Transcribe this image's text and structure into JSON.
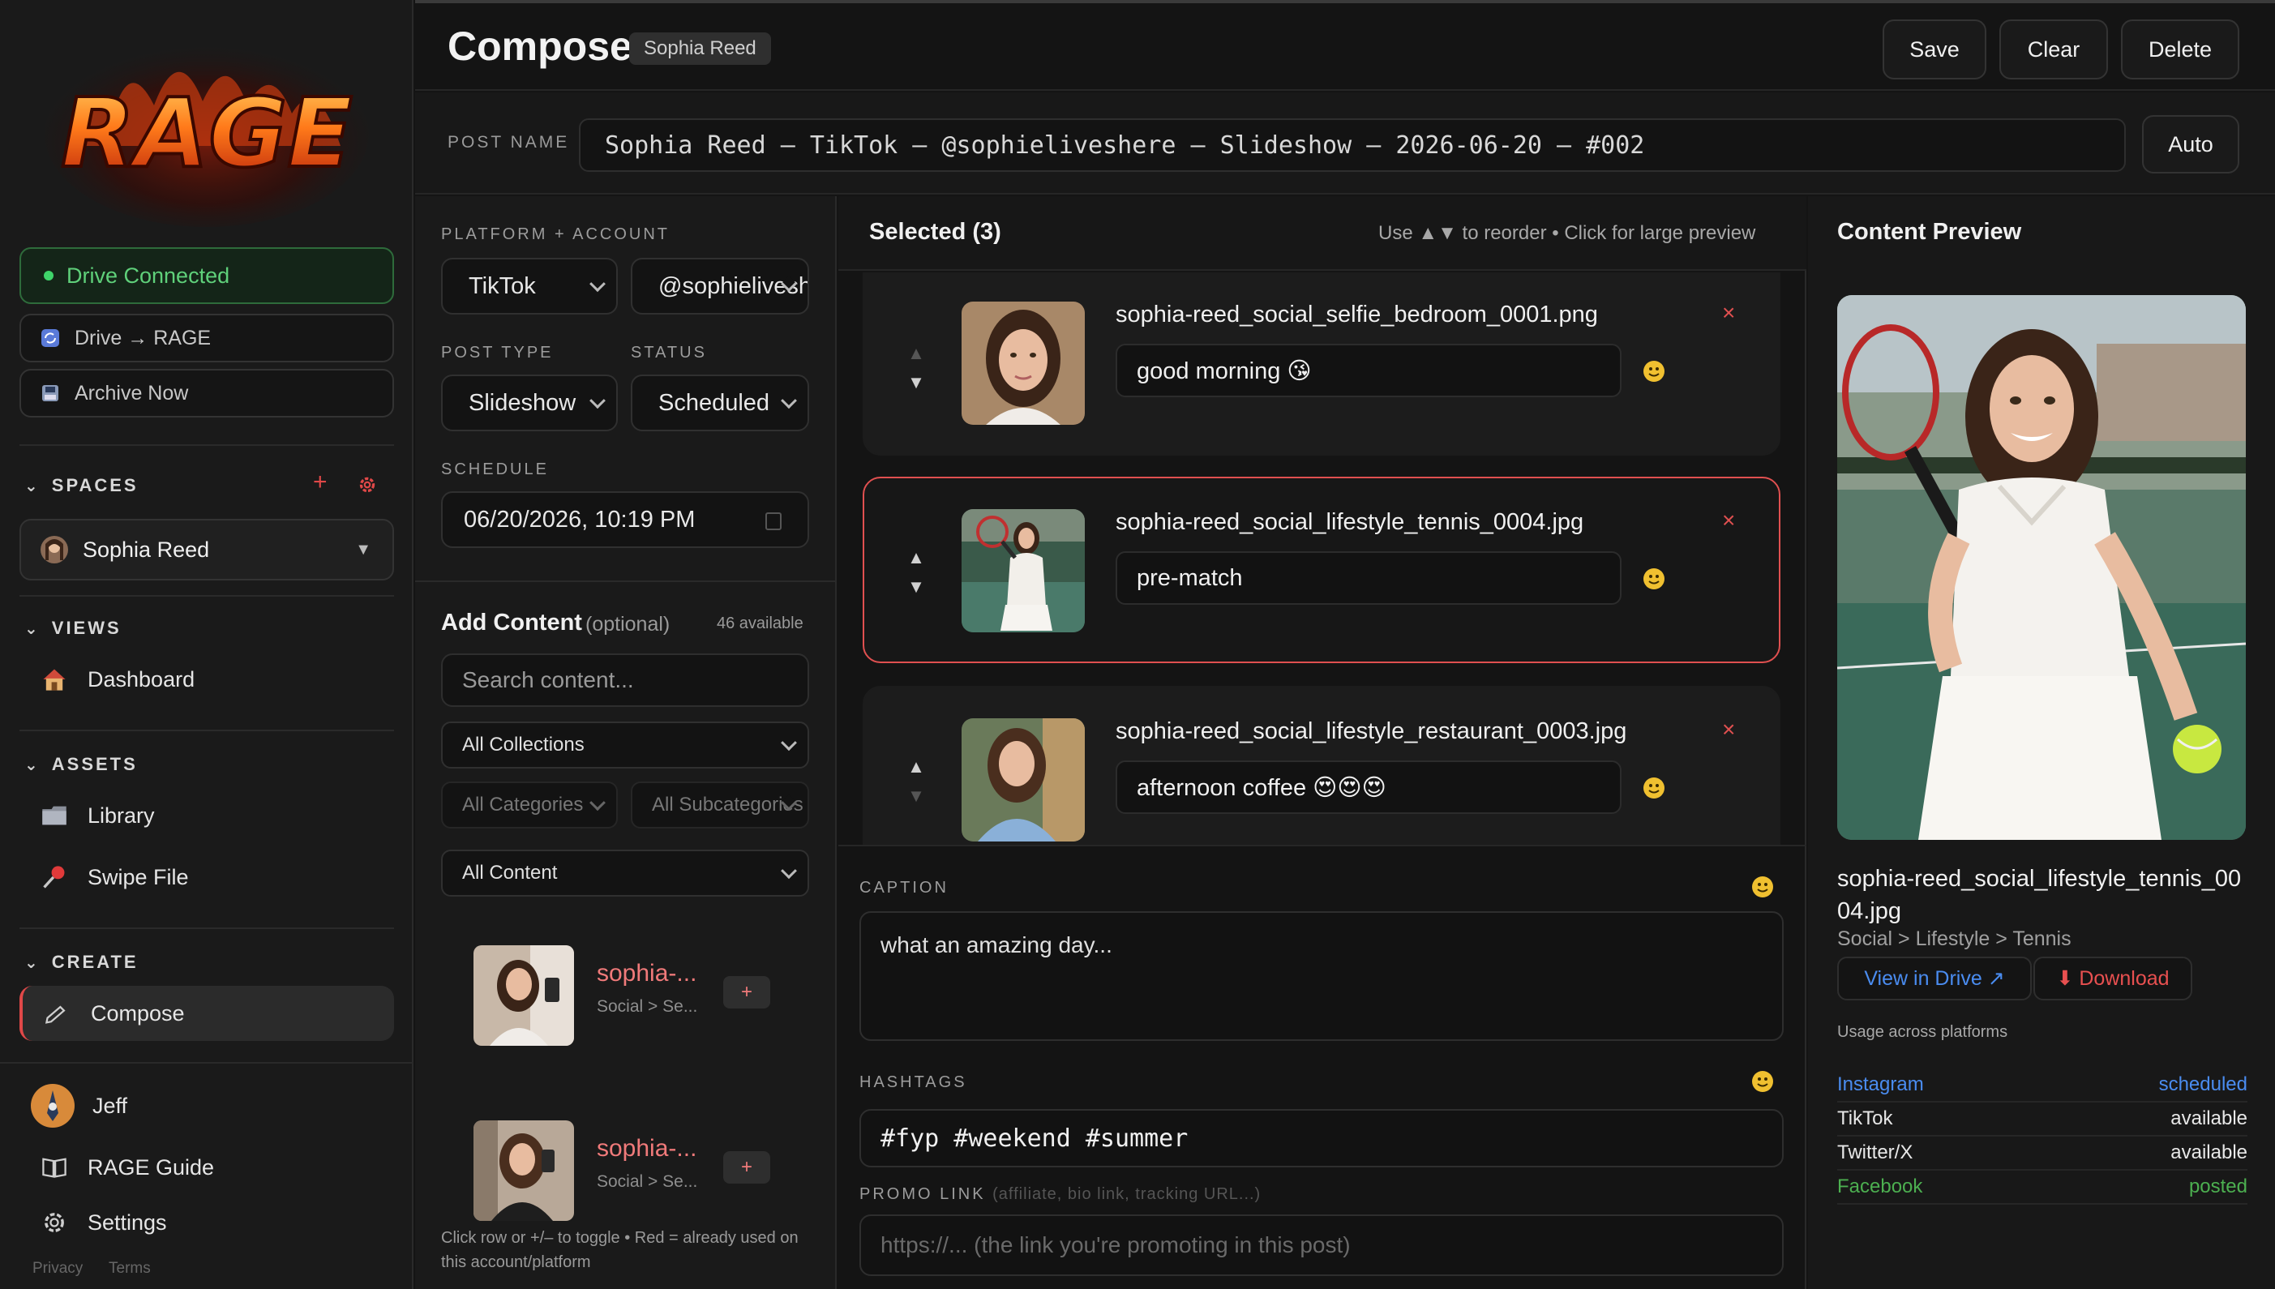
{
  "app": {
    "logo_text": "RAGE"
  },
  "sidebar": {
    "drive_status": "Drive Connected",
    "drive_sync": "Drive → RAGE",
    "archive": "Archive Now",
    "sections": {
      "spaces": "SPACES",
      "views": "VIEWS",
      "assets": "ASSETS",
      "create": "CREATE"
    },
    "space_selected": "Sophia Reed",
    "views": [
      {
        "label": "Dashboard"
      }
    ],
    "assets": [
      {
        "label": "Library"
      },
      {
        "label": "Swipe File"
      }
    ],
    "create": [
      {
        "label": "Compose"
      }
    ],
    "user": "Jeff",
    "guide": "RAGE Guide",
    "settings": "Settings",
    "footer": {
      "privacy": "Privacy",
      "terms": "Terms"
    }
  },
  "header": {
    "title": "Compose",
    "space_badge": "Sophia Reed",
    "save": "Save",
    "clear": "Clear",
    "delete": "Delete"
  },
  "post_name": {
    "label": "POST NAME",
    "value": "Sophia Reed – TikTok – @sophieliveshere – Slideshow – 2026-06-20 – #002",
    "auto": "Auto"
  },
  "form": {
    "platform_label": "PLATFORM + ACCOUNT",
    "platform": "TikTok",
    "account": "@sophieliveshere",
    "post_type_label": "POST TYPE",
    "post_type": "Slideshow",
    "status_label": "STATUS",
    "status": "Scheduled",
    "schedule_label": "SCHEDULE",
    "schedule": "06/20/2026, 10:19 PM"
  },
  "add_content": {
    "title": "Add Content",
    "optional": "(optional)",
    "available": "46 available",
    "search_placeholder": "Search content...",
    "collections": "All Collections",
    "categories": "All Categories",
    "subcategories": "All Subcategories",
    "content_filter": "All Content",
    "items": [
      {
        "name": "sophia-...",
        "category": "Social > Se...",
        "add": "+"
      },
      {
        "name": "sophia-...",
        "category": "Social > Se...",
        "add": "+"
      }
    ],
    "hint": "Click row or +/– to toggle • Red = already used on this account/platform"
  },
  "selected": {
    "title": "Selected (3)",
    "hint": "Use ▲▼ to reorder • Click for large preview",
    "items": [
      {
        "filename": "sophia-reed_social_selfie_bedroom_0001.png",
        "caption": "good morning 😘",
        "remove": "×"
      },
      {
        "filename": "sophia-reed_social_lifestyle_tennis_0004.jpg",
        "caption": "pre-match",
        "remove": "×"
      },
      {
        "filename": "sophia-reed_social_lifestyle_restaurant_0003.jpg",
        "caption": "afternoon coffee 😍😍😍",
        "remove": "×"
      }
    ]
  },
  "caption": {
    "label": "CAPTION",
    "value": "what an amazing day..."
  },
  "hashtags": {
    "label": "HASHTAGS",
    "value": "#fyp #weekend #summer"
  },
  "promo": {
    "label": "PROMO LINK",
    "sublabel": "(affiliate, bio link, tracking URL...)",
    "placeholder": "https://... (the link you're promoting in this post)"
  },
  "preview": {
    "title": "Content Preview",
    "filename": "sophia-reed_social_lifestyle_tennis_0004.jpg",
    "path": "Social > Lifestyle > Tennis",
    "view_drive": "View in Drive ↗",
    "download": "⬇ Download",
    "usage_label": "Usage across platforms",
    "usage": [
      {
        "platform": "Instagram",
        "status": "scheduled",
        "color": "#4a8cf0"
      },
      {
        "platform": "TikTok",
        "status": "available",
        "color": "#e8e8e8"
      },
      {
        "platform": "Twitter/X",
        "status": "available",
        "color": "#e8e8e8"
      },
      {
        "platform": "Facebook",
        "status": "posted",
        "color": "#4caf50"
      }
    ]
  },
  "colors": {
    "accent": "#e04848",
    "connected": "#3fd46a",
    "link": "#4a8cf0"
  }
}
